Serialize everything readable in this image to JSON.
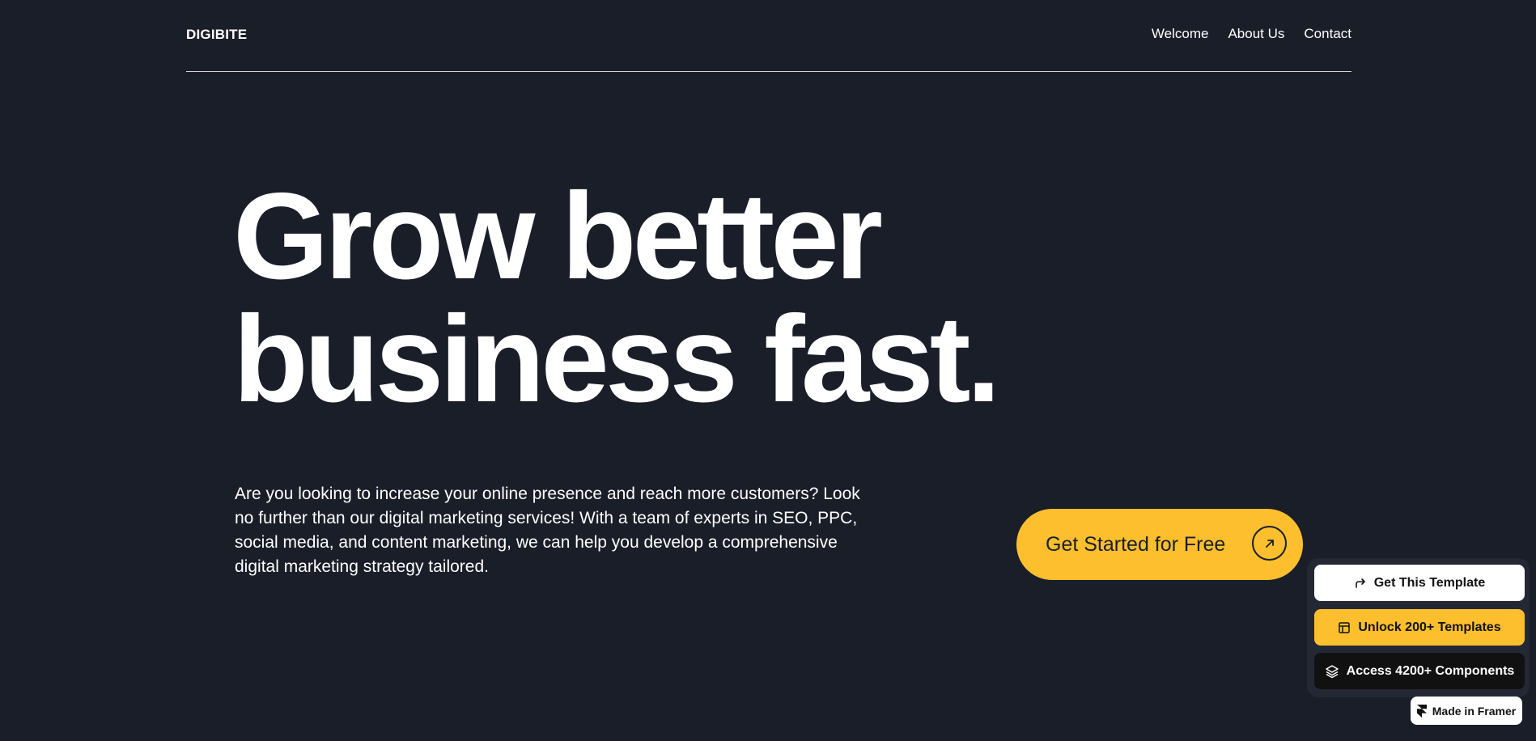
{
  "header": {
    "logo": "DIGIBITE",
    "nav": [
      "Welcome",
      "About Us",
      "Contact"
    ]
  },
  "hero": {
    "title_line1": "Grow better",
    "title_line2": "business fast.",
    "description": "Are you looking to increase your online presence and reach more customers? Look no further than our digital marketing services! With a team of experts in SEO, PPC, social media, and content marketing, we can help you develop a comprehensive digital marketing strategy tailored.",
    "cta_label": "Get Started for Free"
  },
  "promo": {
    "get_template": "Get This Template",
    "unlock_templates": "Unlock 200+ Templates",
    "access_components": "Access 4200+ Components",
    "made_in_framer": "Made in Framer"
  },
  "colors": {
    "background": "#1a1e29",
    "accent": "#fdbf2d",
    "text": "#ffffff"
  },
  "icons": {
    "cta": "arrow-up-right-icon",
    "get_template": "share-arrow-icon",
    "unlock_templates": "layout-icon",
    "access_components": "layers-icon",
    "framer": "framer-logo-icon"
  }
}
